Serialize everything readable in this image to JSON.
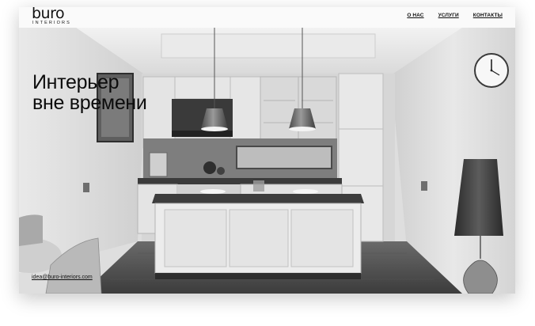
{
  "brand": {
    "logo_word": "buro",
    "logo_sub": "INTERIORS"
  },
  "nav": {
    "items": [
      {
        "label": "О НАС"
      },
      {
        "label": "УСЛУГИ"
      },
      {
        "label": "КОНТАКТЫ"
      }
    ]
  },
  "hero": {
    "headline_line1": "Интерьер",
    "headline_line2": "вне времени"
  },
  "contact": {
    "email": "idea@buro-interiors.com"
  },
  "colors": {
    "text": "#111111",
    "background": "#ffffff"
  }
}
